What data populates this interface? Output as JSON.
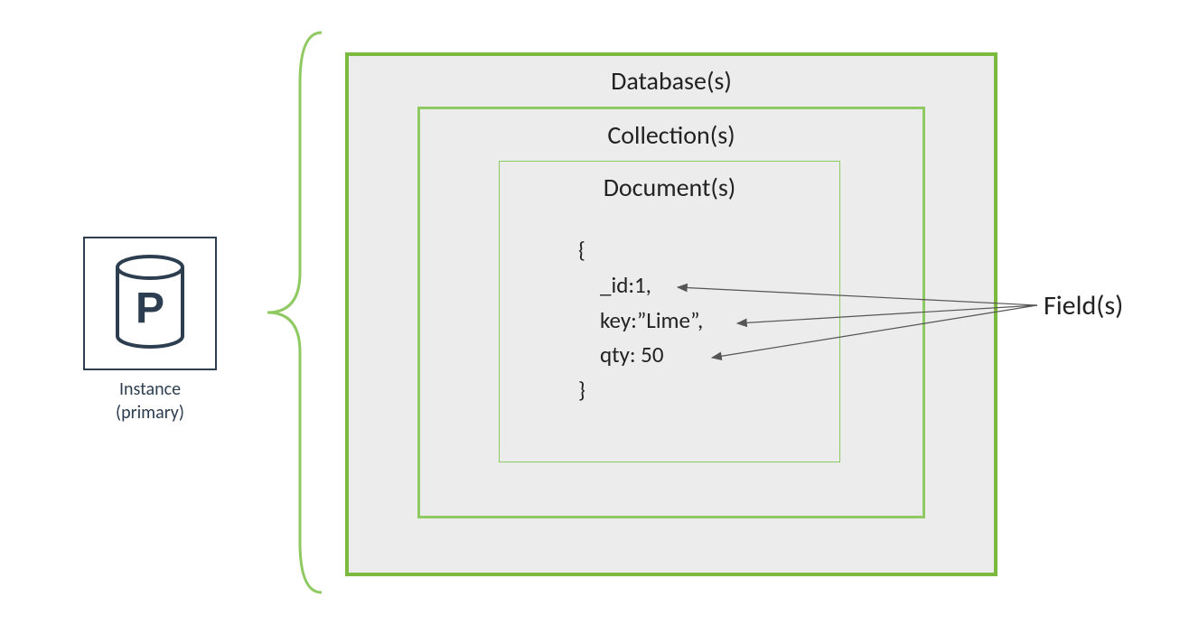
{
  "instance": {
    "label_line1": "Instance",
    "label_line2": "(primary)",
    "icon_letter": "P"
  },
  "database": {
    "label": "Database(s)"
  },
  "collection": {
    "label": "Collection(s)"
  },
  "document": {
    "label": "Document(s)",
    "json": {
      "open": "{",
      "line1": "_id:1,",
      "line2": "key:”Lime”,",
      "line3": "qty: 50",
      "close": "}"
    }
  },
  "fields": {
    "label": "Field(s)"
  }
}
